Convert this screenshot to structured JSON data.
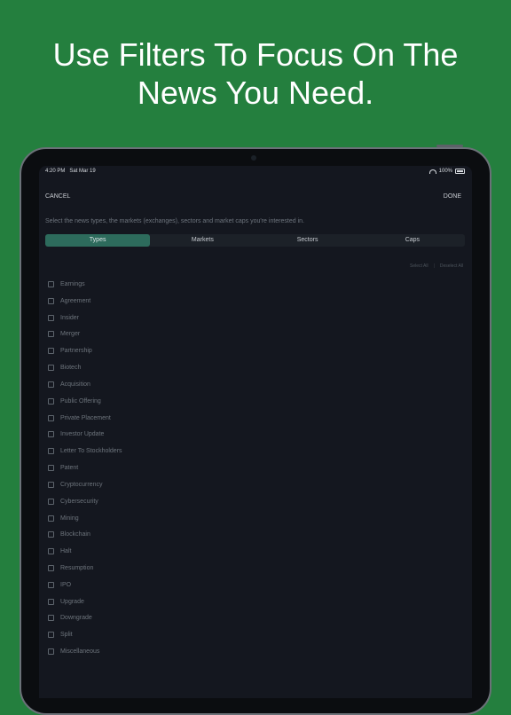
{
  "headline": {
    "line1": "Use Filters To Focus On The",
    "line2": "News You Need."
  },
  "status_bar": {
    "time": "4:20 PM",
    "date": "Sat Mar 19",
    "battery": "100%"
  },
  "nav": {
    "cancel": "CANCEL",
    "done": "DONE"
  },
  "intro": "Select the news types, the markets (exchanges), sectors and market caps you're interested in.",
  "tabs": [
    {
      "label": "Types",
      "active": true
    },
    {
      "label": "Markets",
      "active": false
    },
    {
      "label": "Sectors",
      "active": false
    },
    {
      "label": "Caps",
      "active": false
    }
  ],
  "select_all": "Select All",
  "deselect_all": "Deselect All",
  "items": [
    {
      "label": "Earnings",
      "checked": false
    },
    {
      "label": "Agreement",
      "checked": false
    },
    {
      "label": "Insider",
      "checked": false
    },
    {
      "label": "Merger",
      "checked": false
    },
    {
      "label": "Partnership",
      "checked": false
    },
    {
      "label": "Biotech",
      "checked": false
    },
    {
      "label": "Acquisition",
      "checked": false
    },
    {
      "label": "Public Offering",
      "checked": false
    },
    {
      "label": "Private Placement",
      "checked": false
    },
    {
      "label": "Investor Update",
      "checked": false
    },
    {
      "label": "Letter To Stockholders",
      "checked": false
    },
    {
      "label": "Patent",
      "checked": false
    },
    {
      "label": "Cryptocurrency",
      "checked": false
    },
    {
      "label": "Cybersecurity",
      "checked": false
    },
    {
      "label": "Mining",
      "checked": false
    },
    {
      "label": "Blockchain",
      "checked": false
    },
    {
      "label": "Halt",
      "checked": false
    },
    {
      "label": "Resumption",
      "checked": false
    },
    {
      "label": "IPO",
      "checked": false
    },
    {
      "label": "Upgrade",
      "checked": false
    },
    {
      "label": "Downgrade",
      "checked": false
    },
    {
      "label": "Split",
      "checked": false
    },
    {
      "label": "Miscellaneous",
      "checked": false
    }
  ],
  "colors": {
    "background": "#247f3e",
    "screen": "#14171f",
    "tab_active": "#2d6b5c",
    "muted_text": "#6d747c"
  }
}
